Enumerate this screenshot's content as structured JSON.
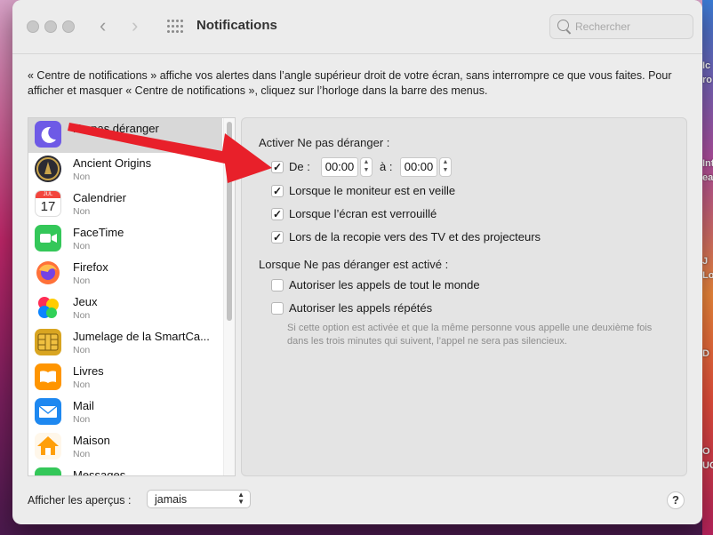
{
  "window": {
    "title": "Notifications",
    "search_placeholder": "Rechercher",
    "description": "« Centre de notifications » affiche vos alertes dans l’angle supérieur droit de votre écran, sans interrompre ce que vous faites. Pour afficher et masquer « Centre de notifications », cliquez sur l’horloge dans la barre des menus."
  },
  "app_list": [
    {
      "name": "Ne pas déranger",
      "status": "",
      "icon": "moon-icon",
      "color": "#6e5ae6",
      "selected": true
    },
    {
      "name": "Ancient Origins",
      "status": "Non",
      "icon": "ancient-origins-icon",
      "color": "#2b2b33"
    },
    {
      "name": "Calendrier",
      "status": "Non",
      "icon": "calendar-icon",
      "color": "#ffffff"
    },
    {
      "name": "FaceTime",
      "status": "Non",
      "icon": "facetime-icon",
      "color": "#34c759"
    },
    {
      "name": "Firefox",
      "status": "Non",
      "icon": "firefox-icon",
      "color": "#ff7139"
    },
    {
      "name": "Jeux",
      "status": "Non",
      "icon": "game-center-icon",
      "color": "#ff2d55"
    },
    {
      "name": "Jumelage de la SmartCa...",
      "status": "Non",
      "icon": "smartcard-chip-icon",
      "color": "#d9a521"
    },
    {
      "name": "Livres",
      "status": "Non",
      "icon": "books-icon",
      "color": "#ff9500"
    },
    {
      "name": "Mail",
      "status": "Non",
      "icon": "mail-icon",
      "color": "#1e88f0"
    },
    {
      "name": "Maison",
      "status": "Non",
      "icon": "home-icon",
      "color": "#ff9f0a"
    },
    {
      "name": "Messages",
      "status": "",
      "icon": "messages-icon",
      "color": "#34c759"
    }
  ],
  "calendar_icon": {
    "month": "JUL",
    "day": "17"
  },
  "dnd": {
    "section_title": "Activer Ne pas déranger :",
    "from_label": "De :",
    "from_checked": true,
    "from_time": "00:00",
    "to_label": "à :",
    "to_time": "00:00",
    "options": [
      {
        "label": "Lorsque le moniteur est en veille",
        "checked": true
      },
      {
        "label": "Lorsque l’écran est verrouillé",
        "checked": true
      },
      {
        "label": "Lors de la recopie vers des TV et des projecteurs",
        "checked": true
      }
    ],
    "active_title": "Lorsque Ne pas déranger est activé :",
    "active_options": [
      {
        "label": "Autoriser les appels de tout le monde",
        "checked": false
      },
      {
        "label": "Autoriser les appels répétés",
        "checked": false
      }
    ],
    "hint": "Si cette option est activée et que la même personne vous appelle une deuxième fois dans les trois minutes qui suivent, l’appel ne sera pas silencieux."
  },
  "bottom": {
    "previews_label": "Afficher les aperçus :",
    "previews_value": "jamais",
    "help_label": "?"
  },
  "desktop_labels": [
    "Ic",
    "ro",
    "Int",
    "ean",
    "J",
    "Lo",
    "D",
    "O",
    "UC"
  ],
  "colors": {
    "arrow": "#e8202a",
    "accent": "#0a64d8"
  }
}
